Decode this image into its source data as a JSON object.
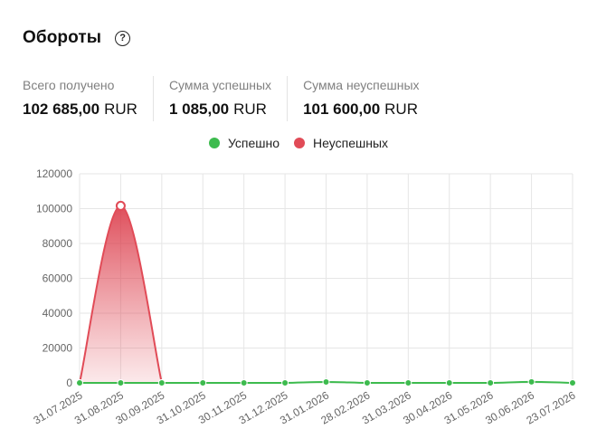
{
  "header": {
    "title": "Обороты",
    "help_icon": "question-circle-icon"
  },
  "stats": [
    {
      "label": "Всего получено",
      "amount": "102 685,00",
      "currency": "RUR"
    },
    {
      "label": "Сумма успешных",
      "amount": "1 085,00",
      "currency": "RUR"
    },
    {
      "label": "Сумма неуспешных",
      "amount": "101 600,00",
      "currency": "RUR"
    }
  ],
  "legend": [
    {
      "label": "Успешно",
      "color": "#3dbb4e"
    },
    {
      "label": "Неуспешных",
      "color": "#e14b57"
    }
  ],
  "chart_data": {
    "type": "area",
    "categories": [
      "31.07.2025",
      "31.08.2025",
      "30.09.2025",
      "31.10.2025",
      "30.11.2025",
      "31.12.2025",
      "31.01.2026",
      "28.02.2026",
      "31.03.2026",
      "30.04.2026",
      "31.05.2026",
      "30.06.2026",
      "23.07.2026"
    ],
    "ylim": [
      0,
      120000
    ],
    "yticks": [
      "0",
      "20000",
      "40000",
      "60000",
      "80000",
      "100000",
      "120000"
    ],
    "grid": true,
    "legend_position": "top-center",
    "series": [
      {
        "name": "Успешно",
        "color": "#3dbb4e",
        "values": [
          0,
          0,
          0,
          0,
          0,
          0,
          500,
          0,
          0,
          0,
          0,
          585,
          0
        ]
      },
      {
        "name": "Неуспешных",
        "color": "#e14b57",
        "values": [
          0,
          101600,
          0,
          null,
          null,
          null,
          null,
          null,
          null,
          null,
          null,
          null,
          null
        ]
      }
    ]
  }
}
